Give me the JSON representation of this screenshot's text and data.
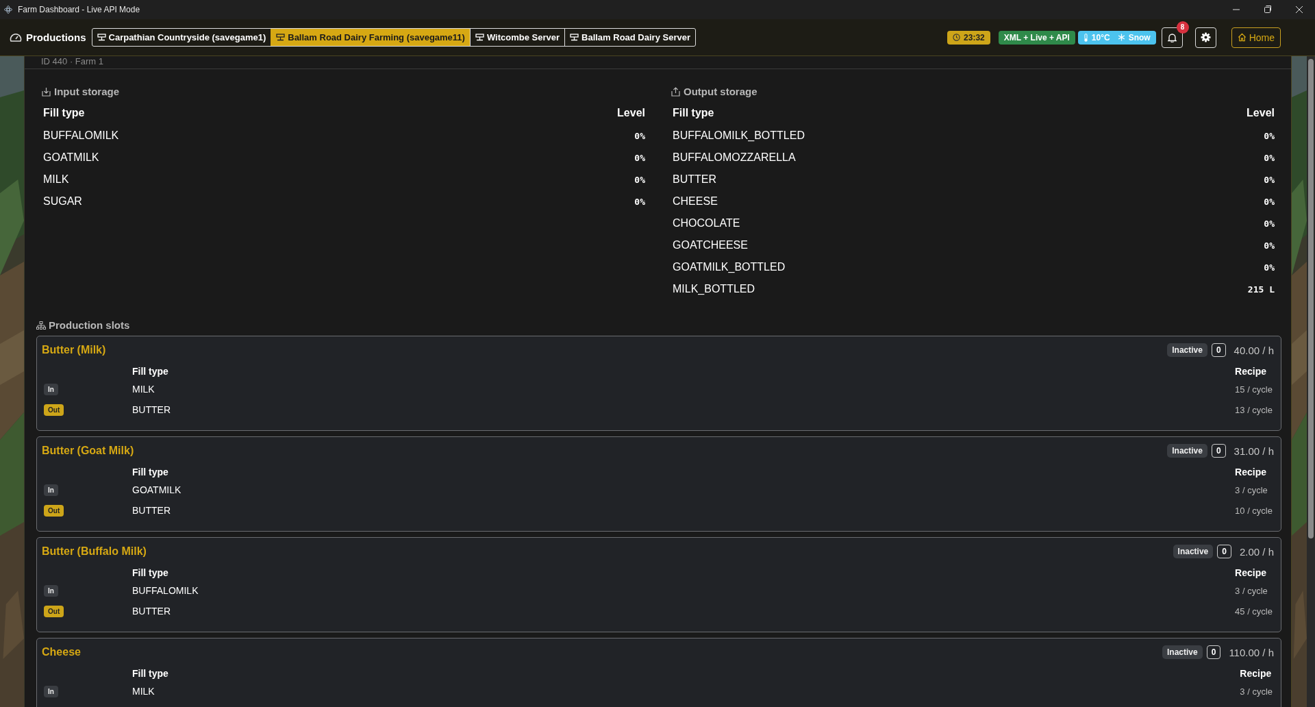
{
  "window": {
    "title": "Farm Dashboard - Live API Mode"
  },
  "header": {
    "title": "Productions",
    "tabs": [
      {
        "label": "Carpathian Countryside (savegame1)",
        "selected": false
      },
      {
        "label": "Ballam Road Dairy Farming (savegame11)",
        "selected": true
      },
      {
        "label": "Witcombe Server",
        "selected": false
      },
      {
        "label": "Ballam Road Dairy Server",
        "selected": false
      }
    ],
    "time": "23:32",
    "mode": "XML + Live + API",
    "temperature": "10°C",
    "weather": "Snow",
    "notifications": "8",
    "home": "Home"
  },
  "production": {
    "subtitle": "ID 440 · Farm 1",
    "input_storage": {
      "title": "Input storage",
      "columns": [
        "Fill type",
        "Level"
      ],
      "rows": [
        {
          "fill_type": "BUFFALOMILK",
          "level": "0%"
        },
        {
          "fill_type": "GOATMILK",
          "level": "0%"
        },
        {
          "fill_type": "MILK",
          "level": "0%"
        },
        {
          "fill_type": "SUGAR",
          "level": "0%"
        }
      ]
    },
    "output_storage": {
      "title": "Output storage",
      "columns": [
        "Fill type",
        "Level"
      ],
      "rows": [
        {
          "fill_type": "BUFFALOMILK_BOTTLED",
          "level": "0%"
        },
        {
          "fill_type": "BUFFALOMOZZARELLA",
          "level": "0%"
        },
        {
          "fill_type": "BUTTER",
          "level": "0%"
        },
        {
          "fill_type": "CHEESE",
          "level": "0%"
        },
        {
          "fill_type": "CHOCOLATE",
          "level": "0%"
        },
        {
          "fill_type": "GOATCHEESE",
          "level": "0%"
        },
        {
          "fill_type": "GOATMILK_BOTTLED",
          "level": "0%"
        },
        {
          "fill_type": "MILK_BOTTLED",
          "level": "215 L"
        }
      ]
    },
    "slots_title": "Production slots",
    "slots": [
      {
        "name": "Butter (Milk)",
        "status": "Inactive",
        "count": "0",
        "rate": "40.00 / h",
        "columns": [
          "Fill type",
          "Recipe"
        ],
        "rows": [
          {
            "kind": "input",
            "badge": "In",
            "fill_type": "MILK",
            "recipe": "15 / cycle"
          },
          {
            "kind": "output",
            "badge": "Out",
            "fill_type": "BUTTER",
            "recipe": "13 / cycle"
          }
        ]
      },
      {
        "name": "Butter (Goat Milk)",
        "status": "Inactive",
        "count": "0",
        "rate": "31.00 / h",
        "columns": [
          "Fill type",
          "Recipe"
        ],
        "rows": [
          {
            "kind": "input",
            "badge": "In",
            "fill_type": "GOATMILK",
            "recipe": "3 / cycle"
          },
          {
            "kind": "output",
            "badge": "Out",
            "fill_type": "BUTTER",
            "recipe": "10 / cycle"
          }
        ]
      },
      {
        "name": "Butter (Buffalo Milk)",
        "status": "Inactive",
        "count": "0",
        "rate": "2.00 / h",
        "columns": [
          "Fill type",
          "Recipe"
        ],
        "rows": [
          {
            "kind": "input",
            "badge": "In",
            "fill_type": "BUFFALOMILK",
            "recipe": "3 / cycle"
          },
          {
            "kind": "output",
            "badge": "Out",
            "fill_type": "BUTTER",
            "recipe": "45 / cycle"
          }
        ]
      },
      {
        "name": "Cheese",
        "status": "Inactive",
        "count": "0",
        "rate": "110.00 / h",
        "columns": [
          "Fill type",
          "Recipe"
        ],
        "rows": [
          {
            "kind": "input",
            "badge": "In",
            "fill_type": "MILK",
            "recipe": "3 / cycle"
          }
        ]
      }
    ]
  }
}
